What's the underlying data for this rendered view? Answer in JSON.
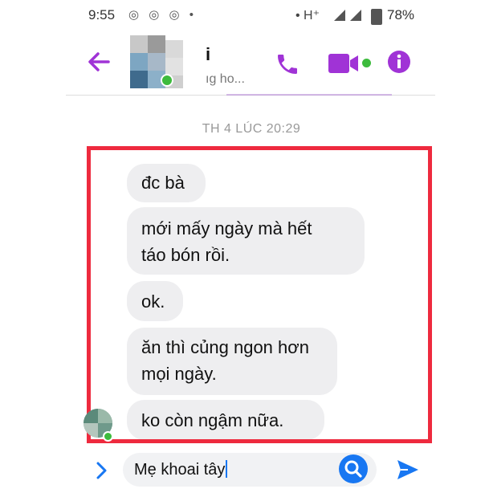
{
  "status_bar": {
    "time": "9:55",
    "app_dots": "◎ ◎ ◎ •",
    "network": "• H⁺",
    "battery_percent": "78%"
  },
  "header": {
    "contact_name": "i",
    "subtitle": "ıg ho...",
    "accent_color": "#a033d6"
  },
  "timestamp": "TH 4 LÚC 20:29",
  "messages": [
    {
      "text": "đc bà"
    },
    {
      "line1": "mới mấy ngày mà hết",
      "line2": "táo bón rồi."
    },
    {
      "text": "ok."
    },
    {
      "line1": "ăn thì củng ngon hơn",
      "line2": "mọi ngày."
    },
    {
      "text": "ko còn ngậm nữa."
    }
  ],
  "highlight_color": "#ee2a3e",
  "composer": {
    "input_value": "Mẹ khoai tây"
  }
}
